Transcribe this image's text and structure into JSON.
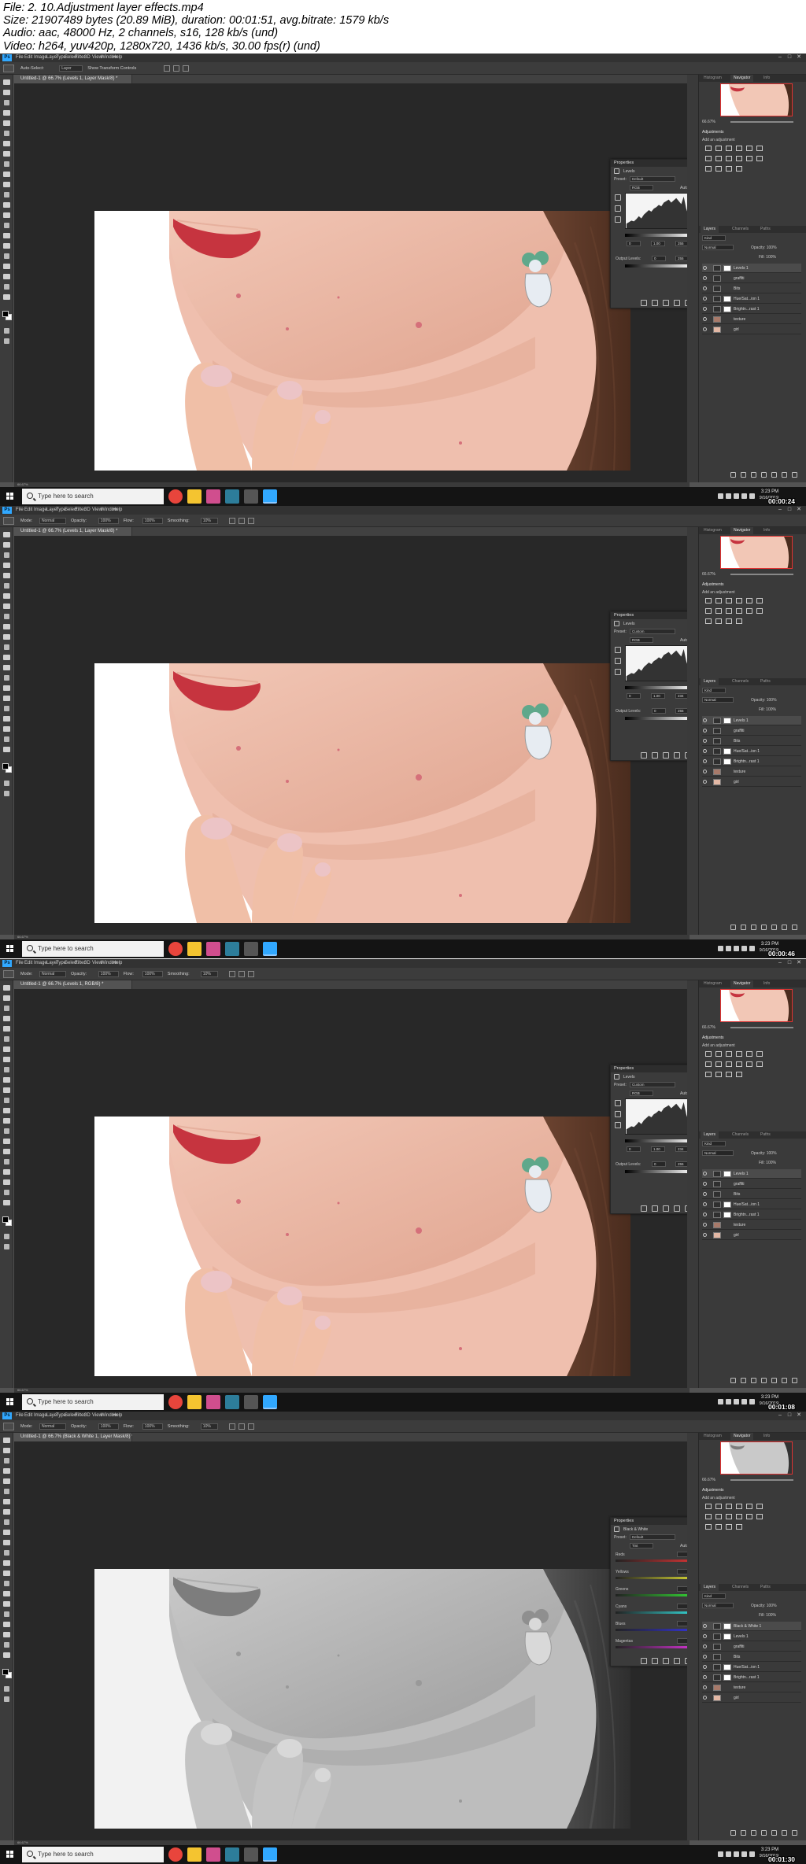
{
  "file_info": {
    "line1": "File: 2. 10.Adjustment layer effects.mp4",
    "line2": "Size: 21907489 bytes (20.89 MiB), duration: 00:01:51, avg.bitrate: 1579 kb/s",
    "line3": "Audio: aac, 48000 Hz, 2 channels, s16, 128 kb/s (und)",
    "line4": "Video: h264, yuv420p, 1280x720, 1436 kb/s, 30.00 fps(r) (und)"
  },
  "menus": [
    "File",
    "Edit",
    "Image",
    "Layer",
    "Type",
    "Select",
    "Filter",
    "3D",
    "View",
    "Window",
    "Help"
  ],
  "taskbar": {
    "search_placeholder": "Type here to search",
    "time": "3:23 PM",
    "date": "9/16/2019"
  },
  "panel_tabs": {
    "top": [
      "Histogram",
      "Navigator",
      "Info"
    ],
    "adjustments": "Adjustments",
    "add_adjustment": "Add an adjustment",
    "layers": [
      "Layers",
      "Channels",
      "Paths"
    ],
    "blend": "Normal",
    "opacity": "Opacity: 100%",
    "fill": "Fill: 100%",
    "kind": "Kind"
  },
  "frames": [
    {
      "timestamp": "00:00:24",
      "tab": "Untitled-1 @ 66.7% (Levels 1, Layer Mask/8) *",
      "zoom": "66.67%",
      "bw": false,
      "options": [
        "Auto-Select:",
        "Layer",
        "Show Transform Controls"
      ],
      "properties": {
        "title": "Properties",
        "sub": "Levels",
        "preset_label": "Preset:",
        "preset": "Default",
        "channel": "RGB",
        "auto": "Auto",
        "in_vals": [
          "0",
          "1.00",
          "255"
        ],
        "output_label": "Output Levels:",
        "out_vals": [
          "0",
          "255"
        ]
      },
      "layers": [
        "Levels 1",
        "graffiti",
        "Bits",
        "Hue/Sat...ion 1",
        "Brightn...rast 1",
        "texture",
        "girl"
      ]
    },
    {
      "timestamp": "00:00:46",
      "tab": "Untitled-1 @ 66.7% (Levels 1, Layer Mask/8) *",
      "zoom": "66.67%",
      "bw": false,
      "options": [
        "Mode:",
        "Normal",
        "Opacity:",
        "100%",
        "Flow:",
        "100%",
        "Smoothing:",
        "10%"
      ],
      "properties": {
        "title": "Properties",
        "sub": "Levels",
        "preset_label": "Preset:",
        "preset": "Custom",
        "channel": "RGB",
        "auto": "Auto",
        "in_vals": [
          "0",
          "1.00",
          "234"
        ],
        "output_label": "Output Levels:",
        "out_vals": [
          "0",
          "255"
        ]
      },
      "layers": [
        "Levels 1",
        "graffiti",
        "Bits",
        "Hue/Sat...ion 1",
        "Brightn...rast 1",
        "texture",
        "girl"
      ]
    },
    {
      "timestamp": "00:01:08",
      "tab": "Untitled-1 @ 66.7% (Levels 1, RGB/8) *",
      "zoom": "66.67%",
      "bw": false,
      "options": [
        "Mode:",
        "Normal",
        "Opacity:",
        "100%",
        "Flow:",
        "100%",
        "Smoothing:",
        "10%"
      ],
      "properties": {
        "title": "Properties",
        "sub": "Levels",
        "preset_label": "Preset:",
        "preset": "Custom",
        "channel": "RGB",
        "auto": "Auto",
        "in_vals": [
          "0",
          "1.00",
          "234"
        ],
        "output_label": "Output Levels:",
        "out_vals": [
          "0",
          "255"
        ]
      },
      "layers": [
        "Levels 1",
        "graffiti",
        "Bits",
        "Hue/Sat...ion 1",
        "Brightn...rast 1",
        "texture",
        "girl"
      ]
    },
    {
      "timestamp": "00:01:30",
      "tab": "Untitled-1 @ 66.7% (Black & White 1, Layer Mask/8) *",
      "zoom": "66.67%",
      "bw": true,
      "options": [
        "Mode:",
        "Normal",
        "Opacity:",
        "100%",
        "Flow:",
        "100%",
        "Smoothing:",
        "10%"
      ],
      "properties": {
        "title": "Properties",
        "sub": "Black & White",
        "preset_label": "Preset:",
        "preset": "Default",
        "channel": "Tint",
        "auto": "Auto",
        "sliders": [
          "Reds",
          "Yellows",
          "Greens",
          "Cyans",
          "Blues",
          "Magentas"
        ]
      },
      "layers": [
        "Black & White 1",
        "Levels 1",
        "graffiti",
        "Bits",
        "Hue/Sat...ion 1",
        "Brightn...rast 1",
        "texture",
        "girl"
      ]
    }
  ],
  "colors": {
    "ps_bg": "#535353",
    "panel": "#3a3a3a",
    "pasteboard": "#282828",
    "taskbar": "#141414",
    "ps_accent": "#31a8ff"
  }
}
